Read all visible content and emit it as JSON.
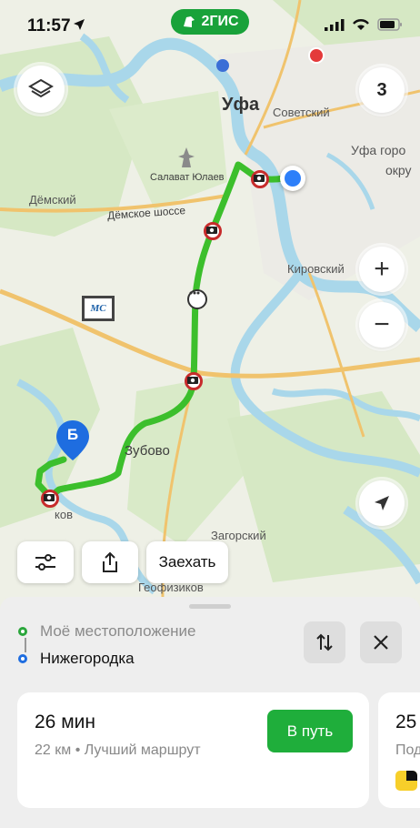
{
  "status_bar": {
    "time": "11:57"
  },
  "brand": {
    "logo_text": "2ГИС"
  },
  "map": {
    "labels": {
      "city": "Уфа",
      "sovetsky": "Советский",
      "ufa_okrug_1": "Уфа горо",
      "ufa_okrug_2": "окру",
      "salavat": "Салават Юлаев",
      "demsky": "Дёмский",
      "demskoe_shosse": "Дёмское шоссе",
      "kirovsky": "Кировский",
      "zubovo": "Зубово",
      "zagorsky": "Загорский",
      "geofizikov": "Геофизиков",
      "kov": "ков",
      "billboard": "MC",
      "destination_marker": "Б"
    },
    "layers_counter": "3",
    "colors": {
      "route": "#3cbf2c",
      "water": "#a9d7ea",
      "user_location": "#2d7ff9",
      "destination_marker": "#1e6de0"
    }
  },
  "map_controls": {
    "zoom_in": "+",
    "zoom_out": "−"
  },
  "map_actions": {
    "stop_button": "Заехать"
  },
  "route_points": {
    "from": "Моё местоположение",
    "to": "Нижегородка"
  },
  "route_card": {
    "duration": "26 мин",
    "summary": "22 км • Лучший маршрут",
    "go_button": "В путь"
  },
  "route_card_alt": {
    "duration_partial": "25",
    "sub_partial": "Под"
  }
}
